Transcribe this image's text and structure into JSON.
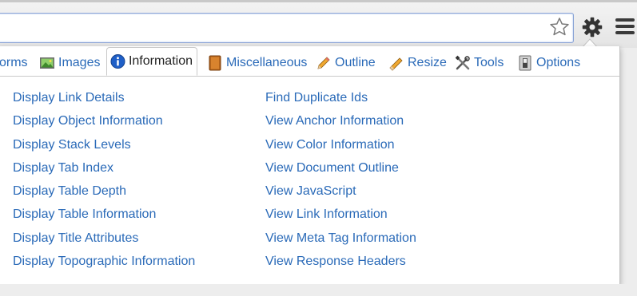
{
  "toolbar": {
    "star_icon": "star-outline-icon",
    "gear_icon": "gear-icon",
    "menu_icon": "hamburger-menu-icon"
  },
  "tabs": [
    {
      "label": "orms",
      "icon": "",
      "active": false
    },
    {
      "label": "Images",
      "icon": "image-icon",
      "active": false
    },
    {
      "label": "Information",
      "icon": "info-icon",
      "active": true
    },
    {
      "label": "Miscellaneous",
      "icon": "book-icon",
      "active": false
    },
    {
      "label": "Outline",
      "icon": "pencil-icon",
      "active": false
    },
    {
      "label": "Resize",
      "icon": "ruler-icon",
      "active": false
    },
    {
      "label": "Tools",
      "icon": "tools-icon",
      "active": false
    },
    {
      "label": "Options",
      "icon": "switch-icon",
      "active": false
    }
  ],
  "left_column": [
    "Display Link Details",
    "Display Object Information",
    "Display Stack Levels",
    "Display Tab Index",
    "Display Table Depth",
    "Display Table Information",
    "Display Title Attributes",
    "Display Topographic Information"
  ],
  "right_column": [
    "Find Duplicate Ids",
    "View Anchor Information",
    "View Color Information",
    "View Document Outline",
    "View JavaScript",
    "View Link Information",
    "View Meta Tag Information",
    "View Response Headers"
  ],
  "colors": {
    "link": "#2a6ab8",
    "active_tab_text": "#222222",
    "info_icon_blue": "#1f5fc7"
  }
}
